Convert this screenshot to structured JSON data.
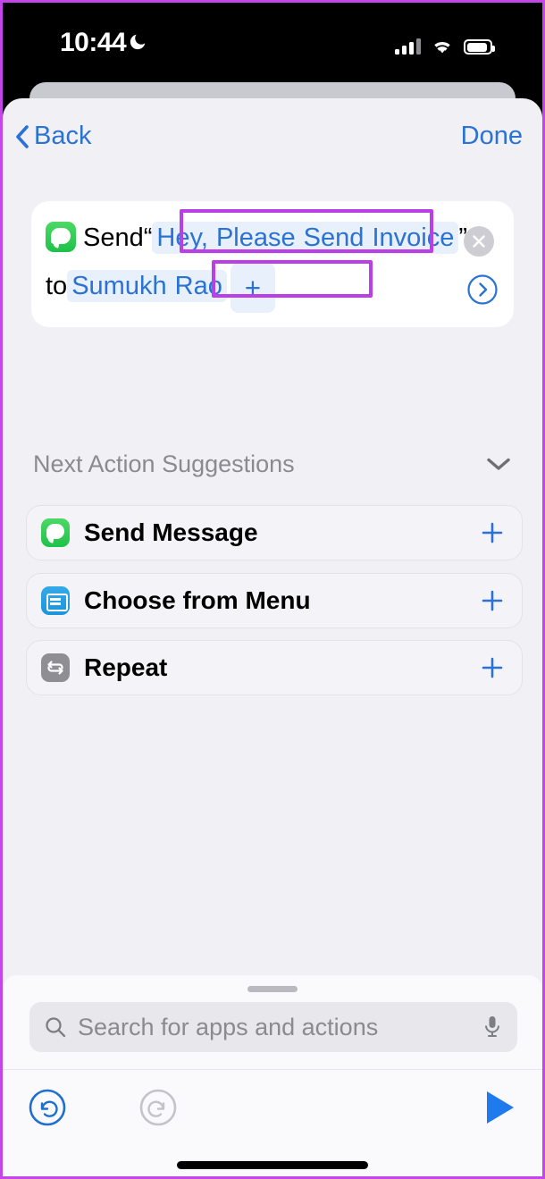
{
  "status_bar": {
    "time": "10:44",
    "icons": [
      "moon-icon",
      "cellular-signal-icon",
      "wifi-icon",
      "battery-icon"
    ]
  },
  "nav": {
    "back_label": "Back",
    "done_label": "Done"
  },
  "action_card": {
    "app_icon": "messages-app-icon",
    "verb": "Send",
    "open_quote": "“",
    "message_text": "Hey, Please Send Invoice",
    "message_line1": "Hey, Please Send",
    "message_line2": "Invoice",
    "close_quote": "”",
    "preposition": "to",
    "recipient": "Sumukh Rao",
    "add_label": "+",
    "remove_icon": "close-circle-icon",
    "expand_icon": "chevron-right-circle-icon"
  },
  "annotations": [
    {
      "name": "message-text-highlight",
      "color": "#bb3fe6"
    },
    {
      "name": "recipient-highlight",
      "color": "#bb3fe6"
    }
  ],
  "suggestions": {
    "title": "Next Action Suggestions",
    "collapse_icon": "chevron-down-icon",
    "items": [
      {
        "label": "Send Message",
        "icon": "messages-app-icon",
        "add": "+"
      },
      {
        "label": "Choose from Menu",
        "icon": "menu-app-icon",
        "add": "+"
      },
      {
        "label": "Repeat",
        "icon": "repeat-icon",
        "add": "+"
      }
    ]
  },
  "bottom_sheet": {
    "search_placeholder": "Search for apps and actions",
    "search_value": "",
    "search_icon": "search-icon",
    "mic_icon": "microphone-icon"
  },
  "toolbar": {
    "undo_icon": "undo-icon",
    "redo_icon": "redo-icon",
    "run_icon": "play-icon",
    "undo_enabled": "true",
    "redo_enabled": "false"
  },
  "colors": {
    "accent_blue": "#2a72d4",
    "annotation_purple": "#bb3fe6",
    "messages_green": "#34c759",
    "menu_blue": "#1b94dd",
    "repeat_gray": "#8e8e93",
    "background": "#f1f0f5"
  }
}
